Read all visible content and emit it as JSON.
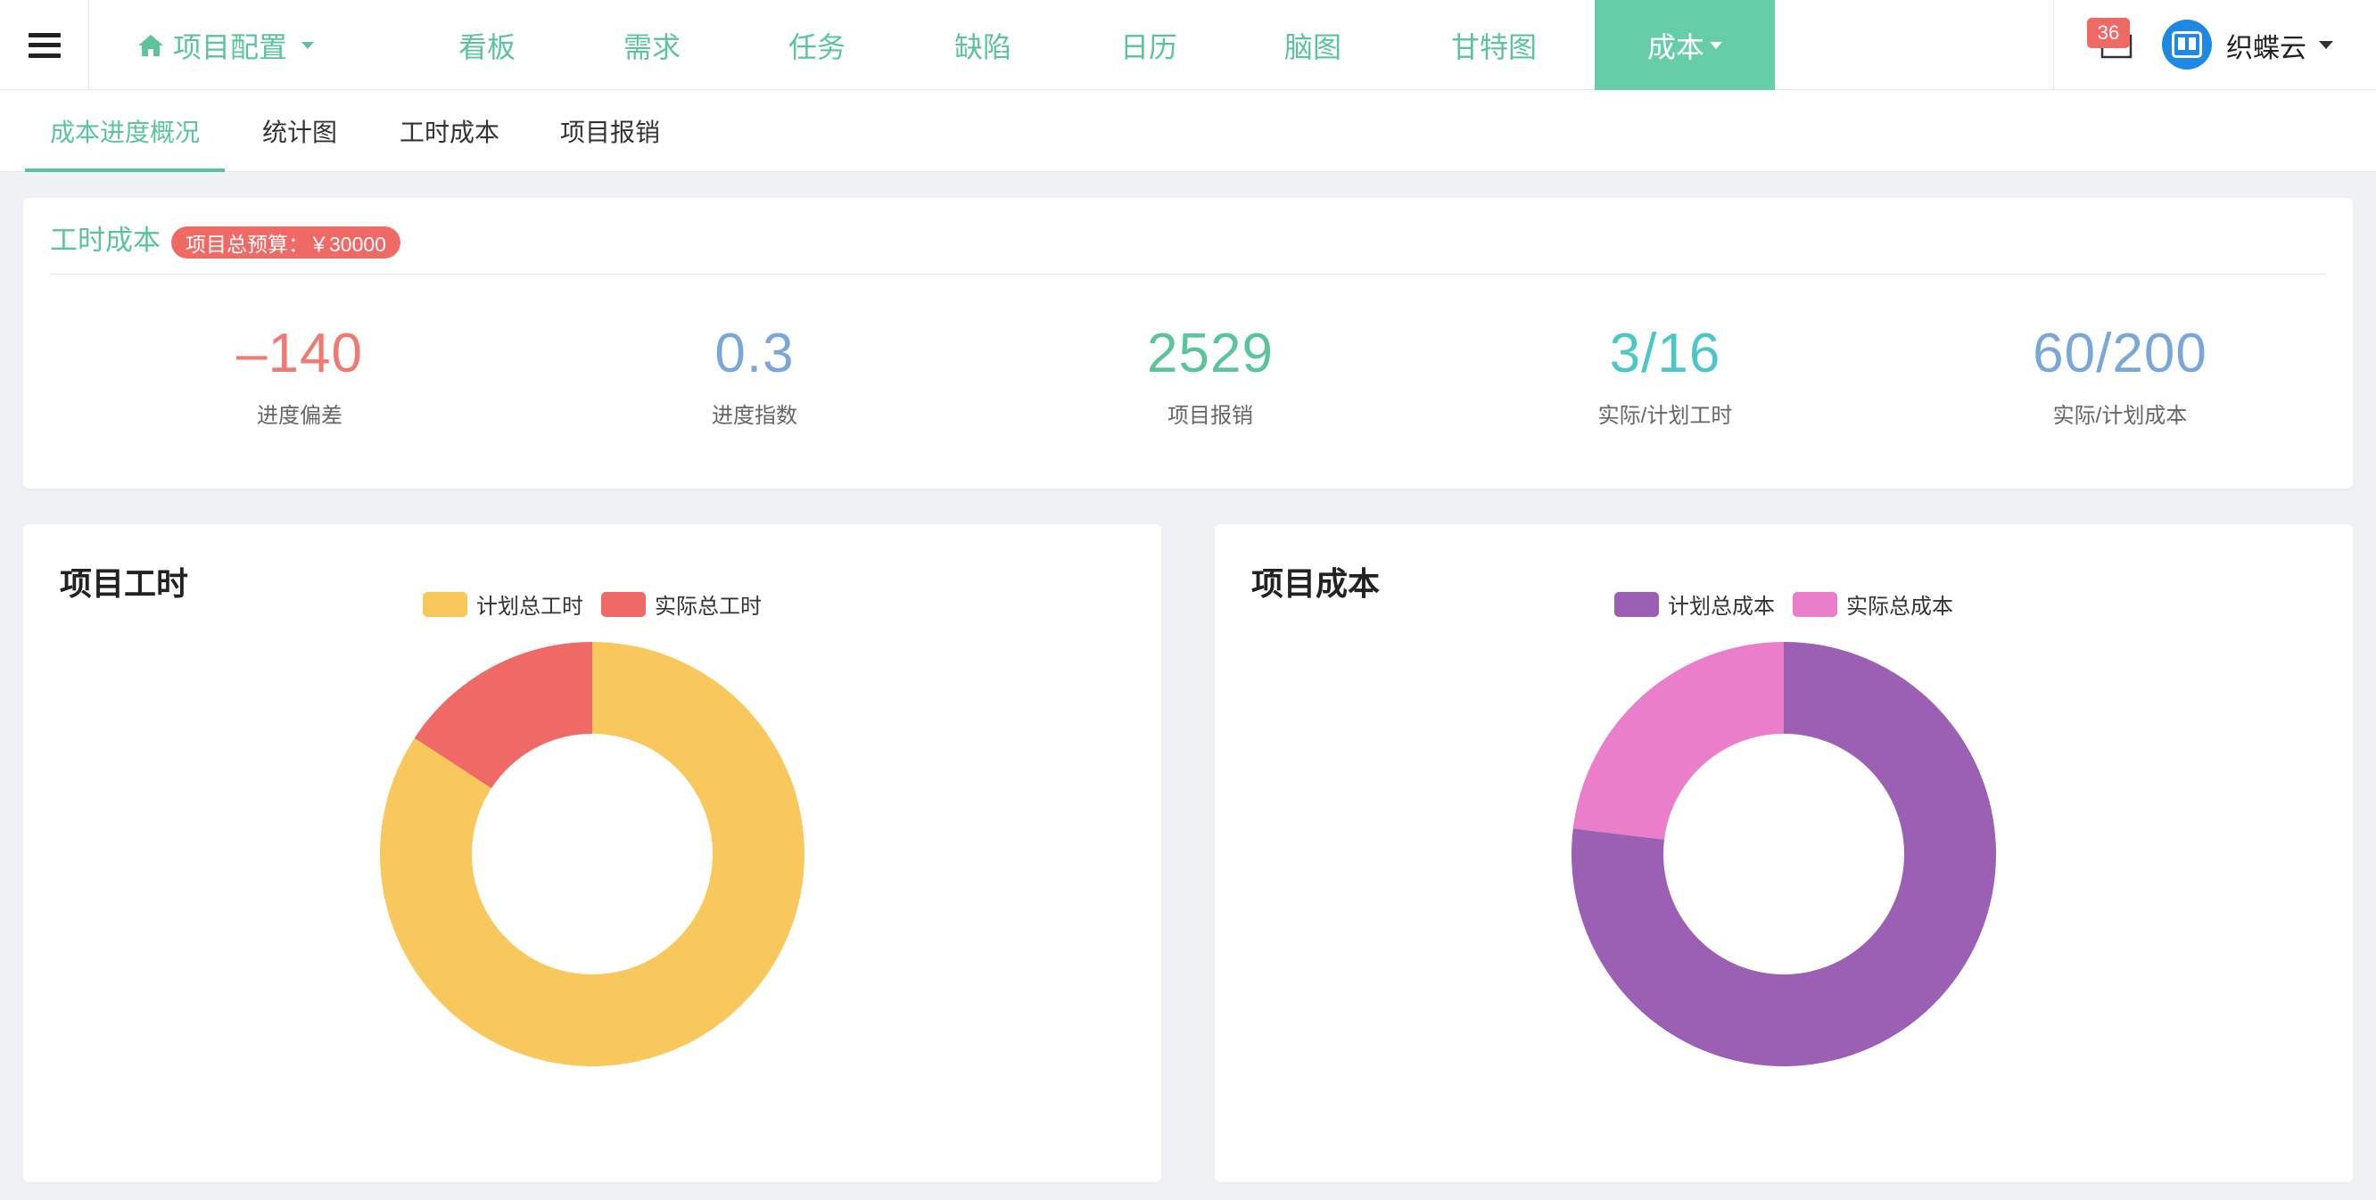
{
  "nav": {
    "project_config": "项目配置",
    "items": [
      "看板",
      "需求",
      "任务",
      "缺陷",
      "日历",
      "脑图",
      "甘特图"
    ],
    "active": "成本",
    "mail_badge": "36",
    "username": "织蝶云"
  },
  "subtabs": [
    "成本进度概况",
    "统计图",
    "工时成本",
    "项目报销"
  ],
  "summary": {
    "title": "工时成本",
    "budget": "项目总预算：￥30000",
    "stats": [
      {
        "value": "–140",
        "label": "进度偏差",
        "color": "#f07a72"
      },
      {
        "value": "0.3",
        "label": "进度指数",
        "color": "#7aa7d8"
      },
      {
        "value": "2529",
        "label": "项目报销",
        "color": "#5cc49a"
      },
      {
        "value": "3/16",
        "label": "实际/计划工时",
        "color": "#4cc6c6"
      },
      {
        "value": "60/200",
        "label": "实际/计划成本",
        "color": "#7aa7d8"
      }
    ]
  },
  "charts": {
    "hours": {
      "title": "项目工时",
      "legend": [
        {
          "name": "计划总工时",
          "color": "#f9c85c"
        },
        {
          "name": "实际总工时",
          "color": "#ef6a67"
        }
      ],
      "values": [
        16,
        3
      ]
    },
    "cost": {
      "title": "项目成本",
      "legend": [
        {
          "name": "计划总成本",
          "color": "#9b5fb4"
        },
        {
          "name": "实际总成本",
          "color": "#ea7ecb"
        }
      ],
      "values": [
        200,
        60
      ]
    }
  },
  "colors": {
    "accent": "#5cc49a",
    "active_tab_bg": "#66cea6",
    "badge": "#f06a65"
  }
}
